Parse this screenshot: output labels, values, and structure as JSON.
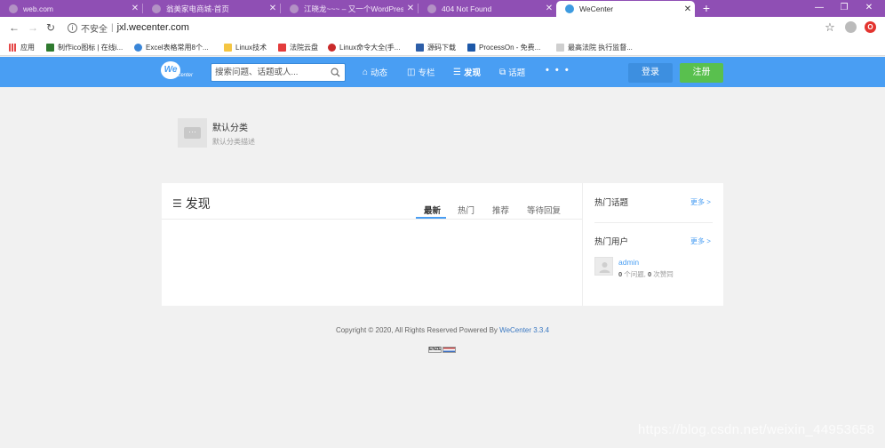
{
  "browser": {
    "tabs": [
      {
        "title": "web.com",
        "active": false
      },
      {
        "title": "翁美家电商城-首页",
        "active": false
      },
      {
        "title": "江晓龙~~~ – 又一个WordPress",
        "active": false
      },
      {
        "title": "404 Not Found",
        "active": false
      },
      {
        "title": "WeCenter",
        "active": true
      }
    ],
    "new_tab": "+",
    "window_controls": {
      "minimize": "—",
      "restore": "❐",
      "close": "✕"
    },
    "address": {
      "security_label": "不安全",
      "url": "jxl.wecenter.com"
    },
    "bookmarks": [
      {
        "label": "应用",
        "color": "#e54848"
      },
      {
        "label": "制作ico图标 | 在线i...",
        "color": "#2f7a2f"
      },
      {
        "label": "Excel表格常用8个...",
        "color": "#3a86d8"
      },
      {
        "label": "Linux技术",
        "color": "#f4c542"
      },
      {
        "label": "法院云盘",
        "color": "#e33c3c"
      },
      {
        "label": "Linux命令大全(手...",
        "color": "#c92a2a"
      },
      {
        "label": "源码下载",
        "color": "#2d5ea8"
      },
      {
        "label": "ProcessOn - 免费...",
        "color": "#1d58a8"
      },
      {
        "label": "最高法院 执行监督...",
        "color": "#cfcfcf"
      }
    ]
  },
  "site": {
    "logo_text": "We",
    "logo_sub": "Center",
    "search": {
      "placeholder": "搜索问题、话题或人..."
    },
    "nav": [
      {
        "label": "动态",
        "icon": "home-icon",
        "active": false
      },
      {
        "label": "专栏",
        "icon": "column-icon",
        "active": false
      },
      {
        "label": "发现",
        "icon": "list-icon",
        "active": true
      },
      {
        "label": "话题",
        "icon": "topic-icon",
        "active": false
      }
    ],
    "more": "• • •",
    "login_label": "登录",
    "register_label": "注册"
  },
  "category": {
    "icon_text": "···",
    "title": "默认分类",
    "description": "默认分类描述"
  },
  "main": {
    "heading": "发现",
    "sort_tabs": [
      {
        "label": "最新",
        "active": true
      },
      {
        "label": "热门",
        "active": false
      },
      {
        "label": "推荐",
        "active": false
      },
      {
        "label": "等待回复",
        "active": false
      }
    ]
  },
  "sidebar": {
    "hot_topics": {
      "title": "热门话题",
      "more": "更多 >"
    },
    "hot_users": {
      "title": "热门用户",
      "more": "更多 >",
      "users": [
        {
          "name": "admin",
          "questions": "0",
          "questions_label": "个问题,",
          "likes": "0",
          "likes_label": "次赞同"
        }
      ]
    }
  },
  "footer": {
    "copyright_prefix": "Copyright © 2020, All Rights Reserved Powered By",
    "product": "WeCenter 3.3.4",
    "flag_label": "ENZE"
  },
  "watermark": "https://blog.csdn.net/weixin_44953658"
}
